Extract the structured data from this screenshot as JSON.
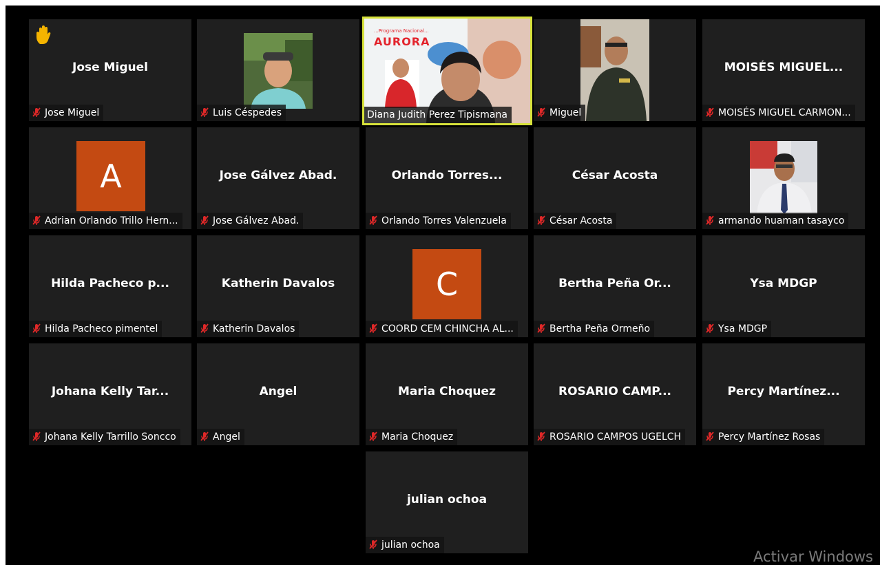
{
  "participants": [
    {
      "display": "Jose Miguel",
      "label": "Jose Miguel"
    },
    {
      "display": "",
      "label": "Luis Céspedes"
    },
    {
      "display": "",
      "label": "Diana Judith Perez Tipismana",
      "banner_title": "AURORA",
      "banner_sub": "...Programa Nacional..."
    },
    {
      "display": "",
      "label": "Miguel"
    },
    {
      "display": "MOISÉS  MIGUEL...",
      "label": "MOISÉS MIGUEL CARMON..."
    },
    {
      "display": "",
      "label": "Adrian Orlando Trillo Hern...",
      "avatar_letter": "A"
    },
    {
      "display": "Jose Gálvez Abad.",
      "label": "Jose Gálvez Abad."
    },
    {
      "display": "Orlando  Torres...",
      "label": "Orlando Torres Valenzuela"
    },
    {
      "display": "César Acosta",
      "label": "César Acosta"
    },
    {
      "display": "",
      "label": "armando huaman tasayco"
    },
    {
      "display": "Hilda  Pacheco  p...",
      "label": "Hilda Pacheco pimentel"
    },
    {
      "display": "Katherin Davalos",
      "label": "Katherin Davalos"
    },
    {
      "display": "",
      "label": "COORD CEM CHINCHA AL...",
      "avatar_letter": "C"
    },
    {
      "display": "Bertha  Peña  Or...",
      "label": "Bertha Peña Ormeño"
    },
    {
      "display": "Ysa MDGP",
      "label": "Ysa MDGP"
    },
    {
      "display": "Johana Kelly Tar...",
      "label": "Johana Kelly Tarrillo Soncco"
    },
    {
      "display": "Angel",
      "label": "Angel"
    },
    {
      "display": "Maria Choquez",
      "label": "Maria Choquez"
    },
    {
      "display": "ROSARIO  CAMP...",
      "label": "ROSARIO CAMPOS UGELCH"
    },
    {
      "display": "Percy  Martínez...",
      "label": "Percy Martínez Rosas"
    },
    {
      "display": "julian ochoa",
      "label": "julian ochoa"
    }
  ],
  "watermark": "Activar Windows",
  "colors": {
    "background": "#000000",
    "tile": "#1f1f1f",
    "active_border": "#d7e23a",
    "avatar": "#c44a12",
    "muted_mic": "#e02828",
    "raised_hand": "#f5b400"
  },
  "icons": [
    "raised-hand-icon",
    "mic-muted-icon"
  ]
}
